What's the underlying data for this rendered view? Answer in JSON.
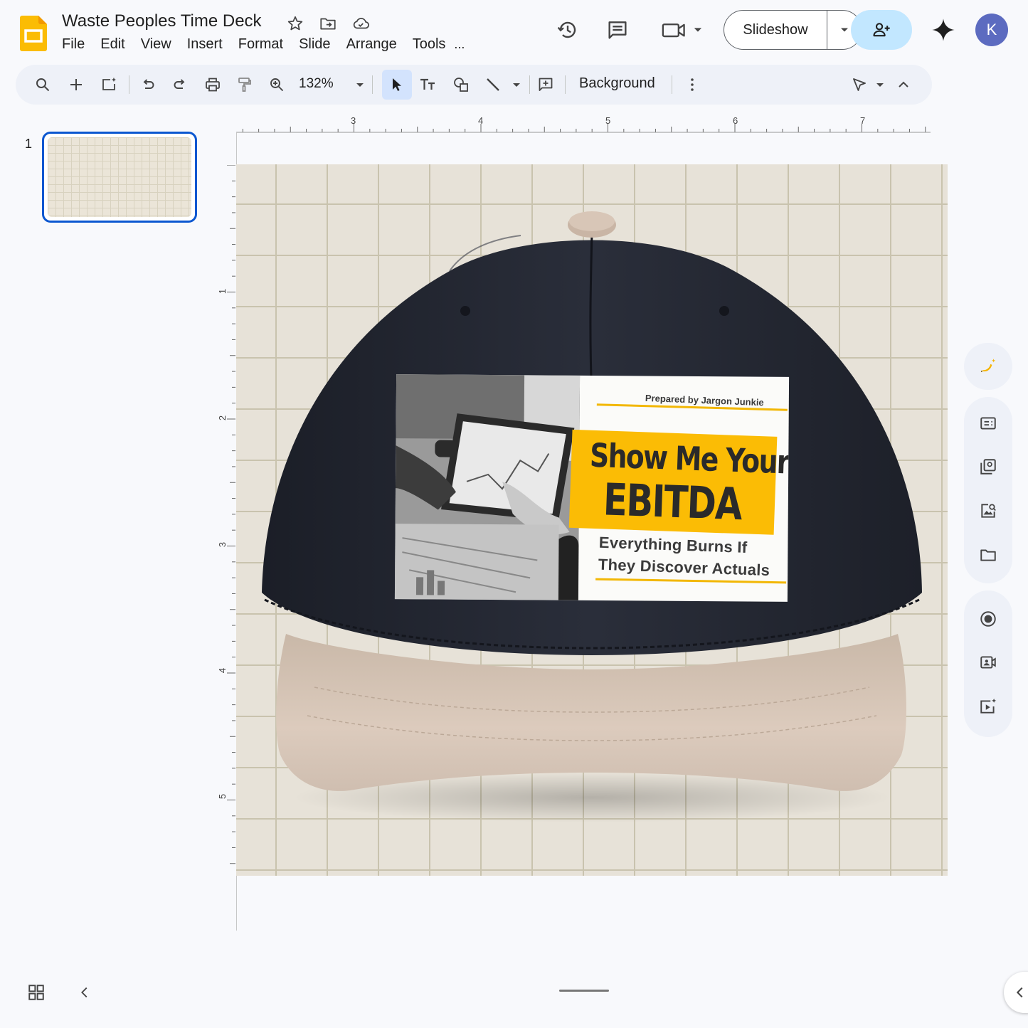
{
  "document": {
    "title": "Waste Peoples Time Deck"
  },
  "menu": [
    "File",
    "Edit",
    "View",
    "Insert",
    "Format",
    "Slide",
    "Arrange",
    "Tools"
  ],
  "menu_more": "...",
  "header": {
    "slideshow_label": "Slideshow",
    "avatar_initial": "K"
  },
  "toolbar": {
    "zoom": "132%",
    "background_label": "Background"
  },
  "filmstrip": {
    "slide_number": "1"
  },
  "rulers": {
    "horizontal": [
      "3",
      "4",
      "5",
      "6",
      "7"
    ],
    "vertical": [
      "1",
      "2",
      "3",
      "4",
      "5"
    ]
  },
  "slide": {
    "patch": {
      "prepared_by": "Prepared by Jargon Junkie",
      "headline_line1": "Show Me Your",
      "headline_line2": "EBITDA",
      "tagline_line1": "Everything Burns If",
      "tagline_line2": "They Discover Actuals"
    }
  },
  "colors": {
    "accent": "#0b57d0",
    "share_bg": "#c2e7ff",
    "avatar_bg": "#5c6bc0",
    "hat_crown": "#252833",
    "hat_brim": "#d8c7b8",
    "patch_yellow": "#fbbc05",
    "slide_bg": "#e7e2d8"
  },
  "icons": {
    "title_bar": [
      "star-icon",
      "move-to-folder-icon",
      "cloud-saved-icon"
    ],
    "header": [
      "version-history-icon",
      "comments-icon",
      "video-call-icon",
      "share-person-add-icon",
      "gemini-sparkle-icon"
    ],
    "toolbar": [
      "search-icon",
      "new-slide-icon",
      "new-slide-ai-icon",
      "undo-icon",
      "redo-icon",
      "print-icon",
      "paint-format-icon",
      "zoom-icon",
      "select-cursor-icon",
      "text-box-icon",
      "shape-icon",
      "line-icon",
      "comment-add-icon",
      "more-vert-icon",
      "pen-tool-icon",
      "collapse-up-icon"
    ],
    "side_panel": [
      "banana-ai-icon",
      "speaker-notes-icon",
      "layouts-icon",
      "image-search-icon",
      "folder-icon",
      "record-icon",
      "camera-icon",
      "animation-icon"
    ]
  }
}
